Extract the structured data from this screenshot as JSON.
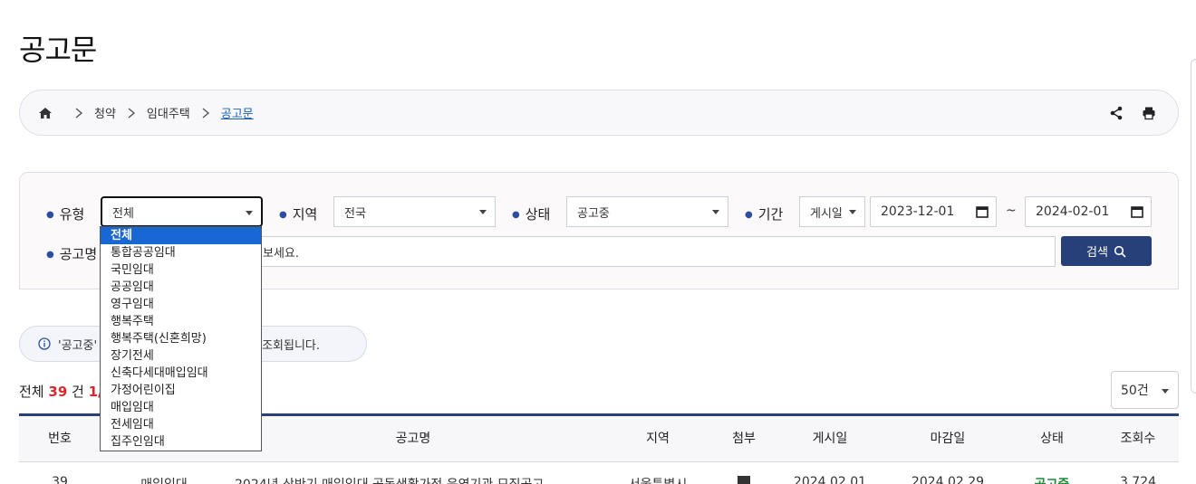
{
  "page": {
    "title": "공고문"
  },
  "breadcrumb": {
    "items": [
      "청약",
      "임대주택"
    ],
    "current": "공고문"
  },
  "filters": {
    "type_label": "유형",
    "type_value": "전체",
    "region_label": "지역",
    "region_value": "전국",
    "status_label": "상태",
    "status_value": "공고중",
    "period_label": "기간",
    "period_type": "게시일",
    "date_from": "2023-12-01",
    "date_to": "2024-02-01",
    "tilde": "~",
    "name_label": "공고명",
    "name_placeholder_visible": "보세요.",
    "search_label": "검색"
  },
  "type_options": [
    "전체",
    "통합공공임대",
    "국민임대",
    "공공임대",
    "영구임대",
    "행복주택",
    "행복주택(신혼희망)",
    "장기전세",
    "신축다세대매입임대",
    "가정어린이집",
    "매입임대",
    "전세임대",
    "집주인임대"
  ],
  "notice": {
    "prefix": "'공고중'",
    "suffix": "모두 조회됩니다."
  },
  "results": {
    "prefix": "전체",
    "total": "39",
    "unit": "건",
    "page": "1/"
  },
  "per_page": "50건",
  "table": {
    "headers": [
      "번호",
      "공고명",
      "지역",
      "첨부",
      "게시일",
      "마감일",
      "상태",
      "조회수"
    ],
    "row": [
      "39",
      "매입임대",
      "2024년 상반기 매입임대 공동생활가정 운영기관 모집공고",
      "서울특별시",
      "2024.02.01",
      "2024.02.29",
      "공고중",
      "3,724"
    ]
  },
  "colors": {
    "accent": "#27407a",
    "selected_option": "#1967d2",
    "count_highlight": "#d6282e",
    "status_open": "#1f8a3a"
  }
}
